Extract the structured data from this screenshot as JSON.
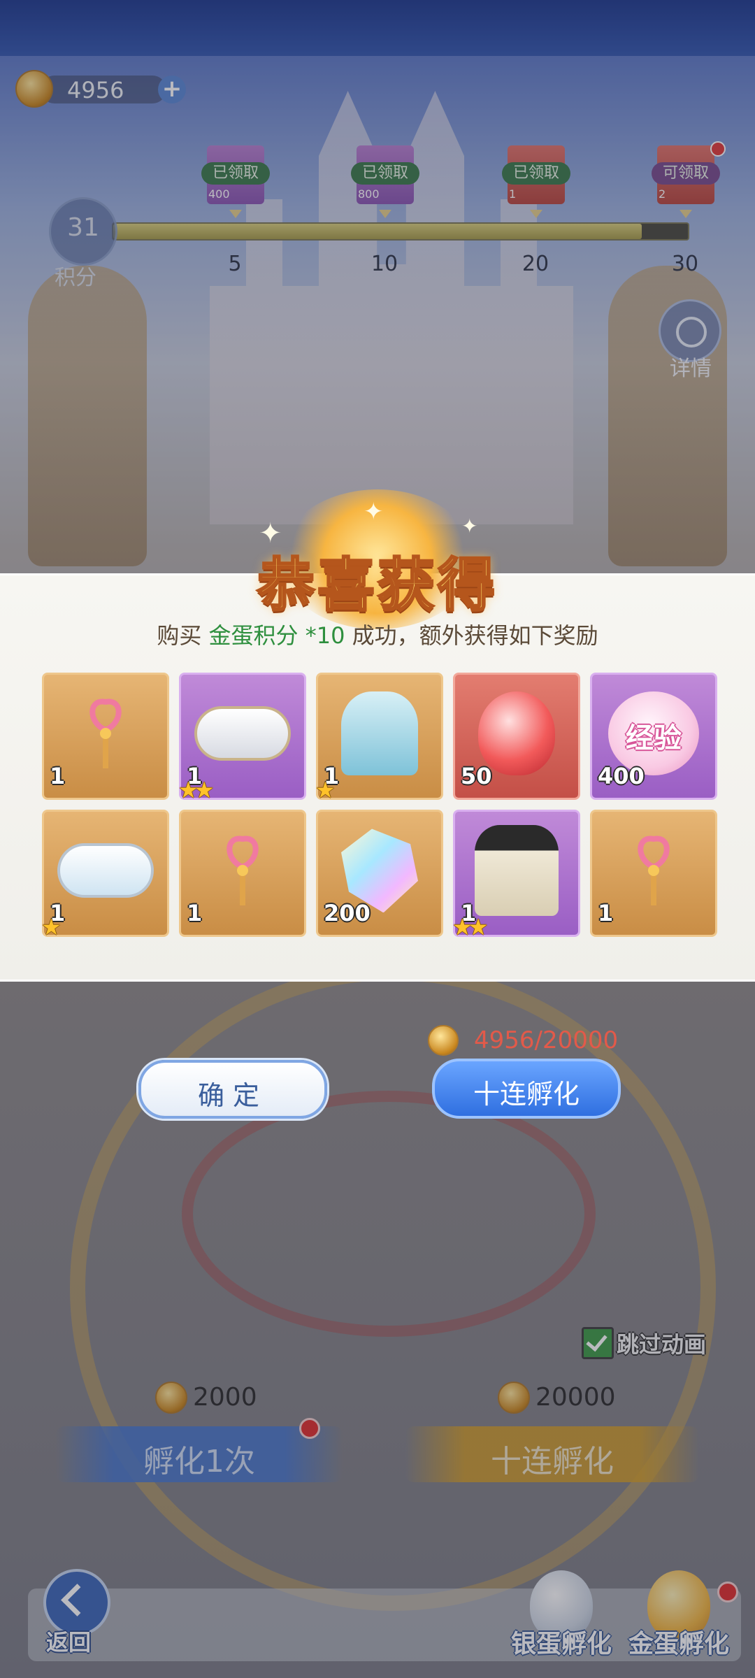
{
  "hud": {
    "currency_value": "4956",
    "plus_label": "+",
    "score_value": "31",
    "score_label": "积分",
    "details_label": "详情",
    "progress_fraction": 0.92
  },
  "milestones": [
    {
      "status": "已领取",
      "count": "400",
      "threshold": "5"
    },
    {
      "status": "已领取",
      "count": "800",
      "threshold": "10"
    },
    {
      "status": "已领取",
      "count": "1",
      "threshold": "20"
    },
    {
      "status": "可领取",
      "count": "2",
      "threshold": "30"
    }
  ],
  "popup": {
    "title": "恭喜获得",
    "subtitle_prefix": "购买",
    "subtitle_highlight": "金蛋积分",
    "subtitle_qty": "*10",
    "subtitle_suffix": "成功，额外获得如下奖励",
    "items": [
      {
        "icon": "wand-icon",
        "count": "1",
        "stars": "",
        "rarity": "orange"
      },
      {
        "icon": "ring-icon",
        "count": "1",
        "stars": "★★",
        "rarity": "purple"
      },
      {
        "icon": "cape-icon",
        "count": "1",
        "stars": "★",
        "rarity": "orange"
      },
      {
        "icon": "ruby-gem-icon",
        "count": "50",
        "stars": "",
        "rarity": "red"
      },
      {
        "icon": "exp-egg-icon",
        "count": "400",
        "stars": "",
        "rarity": "purple",
        "label": "经验"
      },
      {
        "icon": "ring-icon",
        "count": "1",
        "stars": "★",
        "rarity": "orange"
      },
      {
        "icon": "wand-icon",
        "count": "1",
        "stars": "",
        "rarity": "orange"
      },
      {
        "icon": "crystal-icon",
        "count": "200",
        "stars": "",
        "rarity": "orange"
      },
      {
        "icon": "robe-icon",
        "count": "1",
        "stars": "★★",
        "rarity": "purple"
      },
      {
        "icon": "wand-icon",
        "count": "1",
        "stars": "",
        "rarity": "orange"
      }
    ]
  },
  "actions": {
    "confirm_label": "确定",
    "ten_hatch_label": "十连孵化",
    "cost_progress": "4956/20000"
  },
  "lower": {
    "skip_label": "跳过动画",
    "single_cost": "2000",
    "ten_cost": "20000",
    "single_hatch_label": "孵化1次",
    "ten_hatch_label": "十连孵化"
  },
  "bottom": {
    "back_label": "返回",
    "silver_tab_label": "银蛋孵化",
    "gold_tab_label": "金蛋孵化"
  },
  "colors": {
    "accent_blue": "#2f6fe0",
    "highlight_green": "#2e8f3e",
    "cost_red": "#e25a4a"
  }
}
